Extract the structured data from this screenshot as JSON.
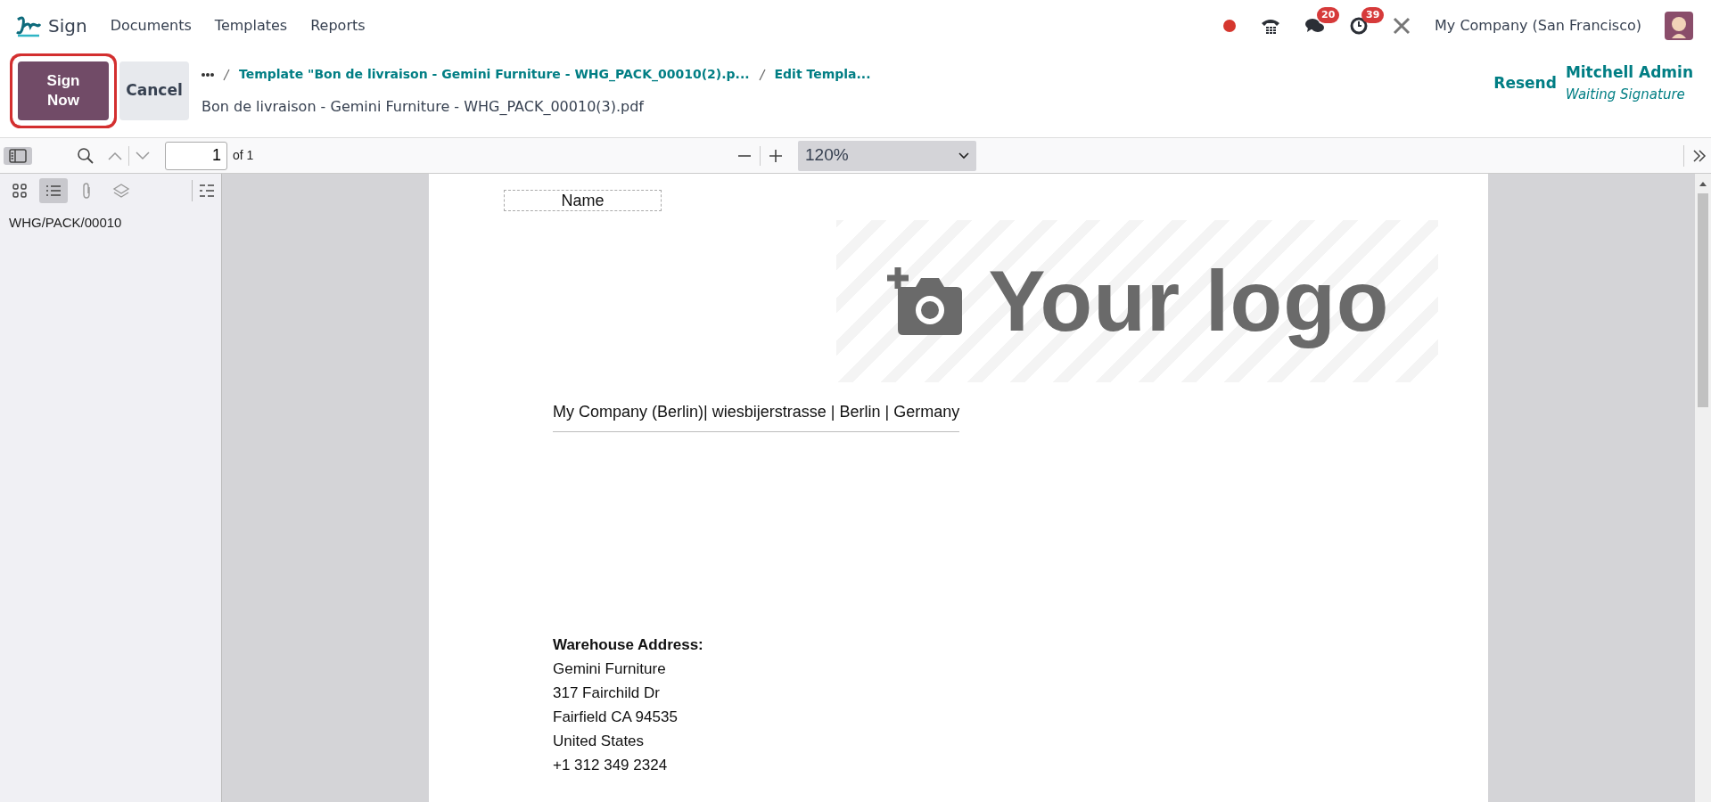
{
  "navbar": {
    "app": "Sign",
    "menu": [
      "Documents",
      "Templates",
      "Reports"
    ],
    "chat_count": "20",
    "activity_count": "39",
    "company": "My Company (San Francisco)"
  },
  "control_panel": {
    "buttons": [
      {
        "label": "Sign Now",
        "kind": "primary",
        "highlighted": true
      },
      {
        "label": "Cancel",
        "kind": "secondary",
        "highlighted": false
      }
    ],
    "breadcrumbs": [
      "Template \"Bon de livraison - Gemini Furniture - WHG_PACK_00010(2).p...",
      "Edit Templa..."
    ],
    "title": "Bon de livraison - Gemini Furniture - WHG_PACK_00010(3).pdf",
    "resend": "Resend",
    "signer": {
      "name": "Mitchell Admin",
      "status": "Waiting Signature"
    }
  },
  "viewer": {
    "page_number": "1",
    "page_count": "of 1",
    "zoom": "120%",
    "sidebar_tabs": [
      {
        "kind": "thumbnails",
        "selected": false
      },
      {
        "kind": "outline",
        "selected": true
      },
      {
        "kind": "attachments",
        "selected": false
      },
      {
        "kind": "layers",
        "selected": false
      }
    ],
    "outline": [
      "WHG/PACK/00010"
    ]
  },
  "document": {
    "field": "Name",
    "logo": "Your logo",
    "company_line": "My Company (Berlin)| wiesbijerstrasse | Berlin | Germany",
    "address_heading": "Warehouse Address:",
    "address_lines": [
      "Gemini Furniture",
      "317 Fairchild Dr",
      "Fairfield CA 94535",
      "United States",
      "+1 312 349 2324"
    ]
  }
}
